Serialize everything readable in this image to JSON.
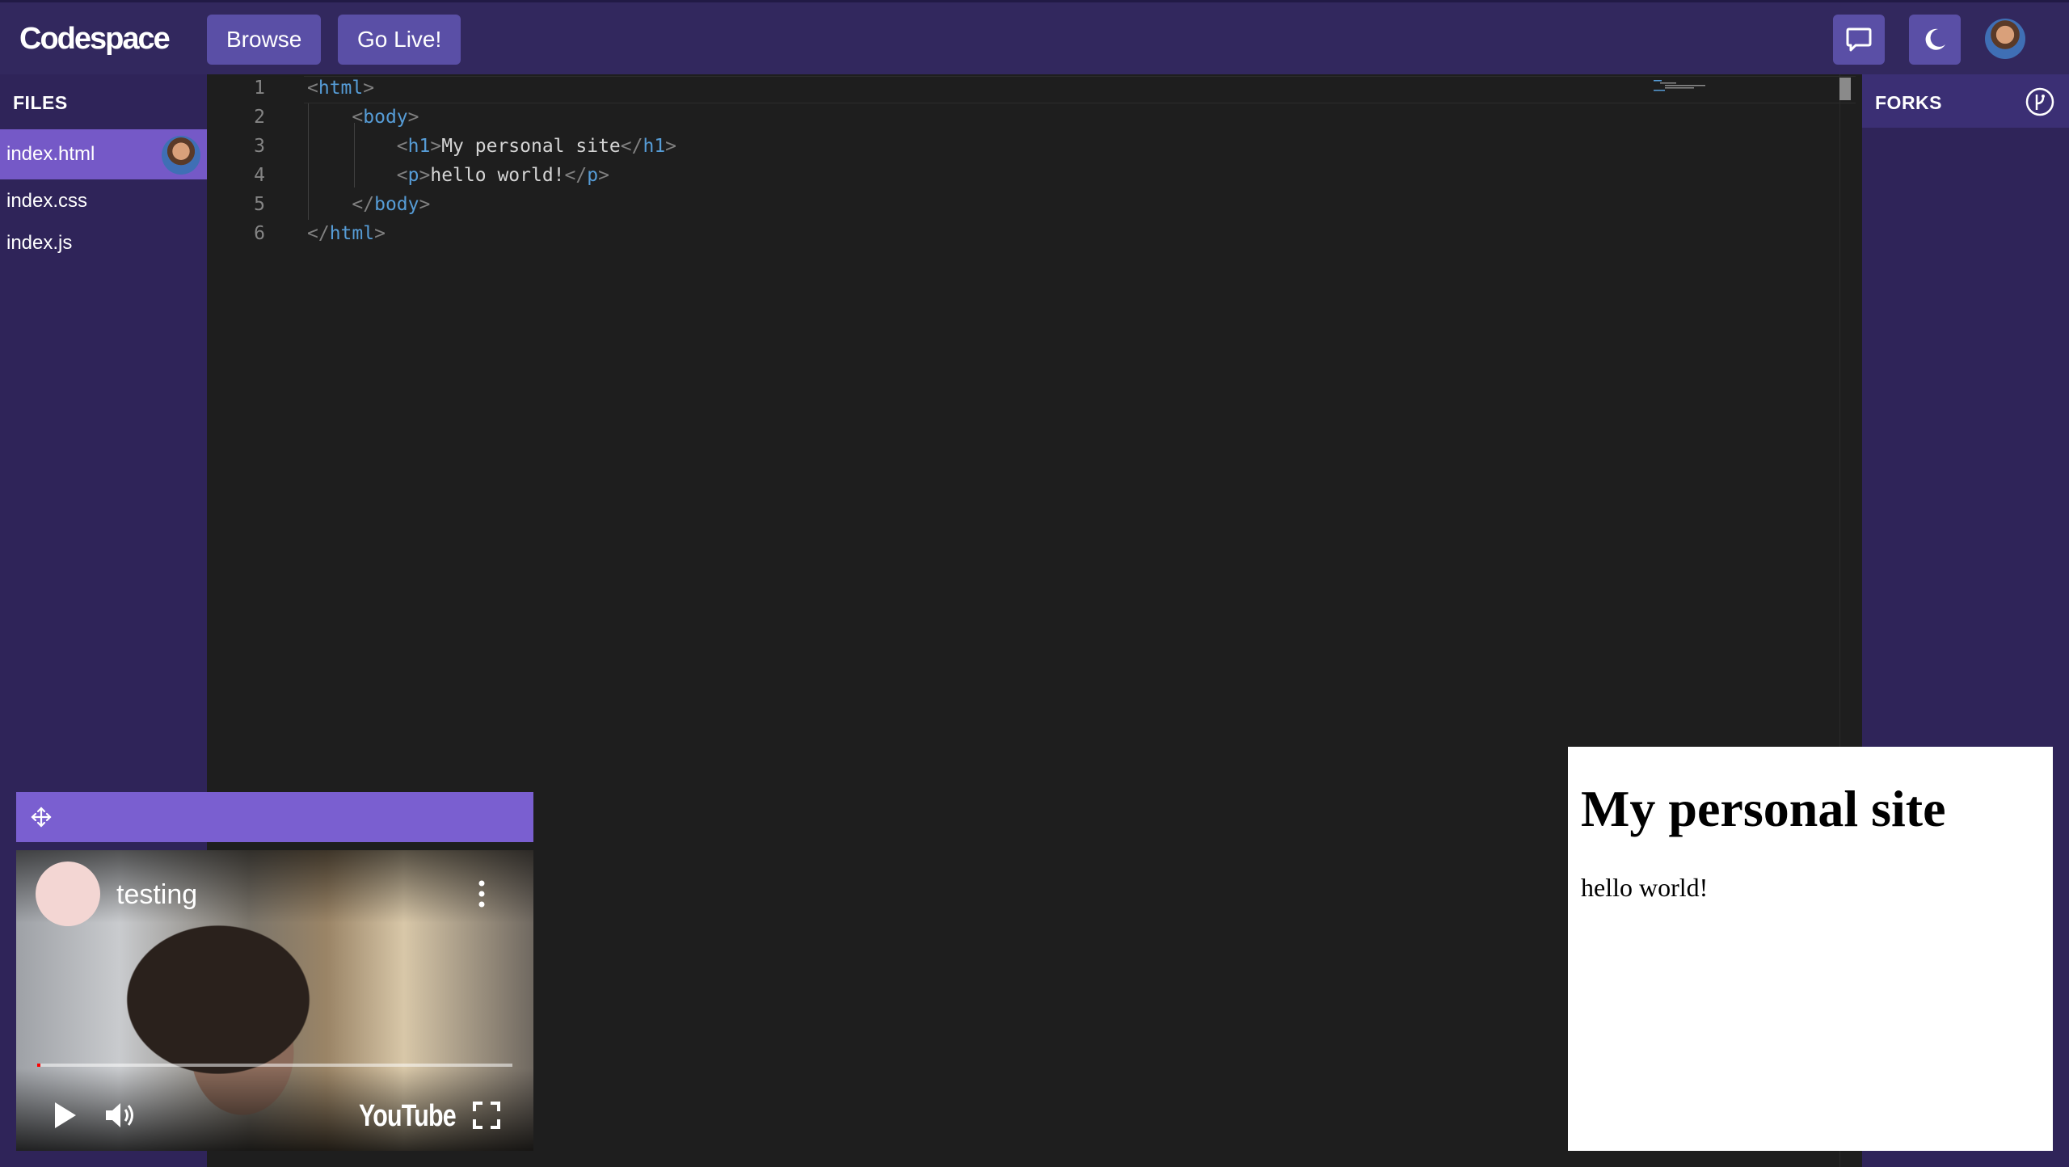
{
  "header": {
    "logo": "Codespace",
    "browse_label": "Browse",
    "go_live_label": "Go Live!",
    "icons": [
      "chat-icon",
      "moon-icon",
      "avatar"
    ]
  },
  "files_panel": {
    "title": "FILES",
    "files": [
      {
        "name": "index.html",
        "active": true
      },
      {
        "name": "index.css",
        "active": false
      },
      {
        "name": "index.js",
        "active": false
      }
    ]
  },
  "editor": {
    "language": "html",
    "lines": [
      {
        "n": "1",
        "code": "<html>"
      },
      {
        "n": "2",
        "code": "    <body>"
      },
      {
        "n": "3",
        "code": "        <h1>My personal site</h1>"
      },
      {
        "n": "4",
        "code": "        <p>hello world!</p>"
      },
      {
        "n": "5",
        "code": "    </body>"
      },
      {
        "n": "6",
        "code": "</html>"
      }
    ]
  },
  "forks_panel": {
    "title": "FORKS",
    "icon": "fork-icon"
  },
  "preview": {
    "heading": "My personal site",
    "paragraph": "hello world!"
  },
  "video": {
    "title": "testing",
    "platform_logo": "YouTube",
    "progress": 0.005,
    "icons": [
      "move-icon",
      "more-vert-icon",
      "play-icon",
      "volume-icon",
      "fullscreen-icon"
    ]
  },
  "colors": {
    "nav_bg": "#32285e",
    "sidebar_bg": "#2f2459",
    "button_bg": "#5a4fa6",
    "active_file_bg": "#7559c7",
    "editor_bg": "#1e1e1e",
    "tag_color": "#569cd6"
  }
}
